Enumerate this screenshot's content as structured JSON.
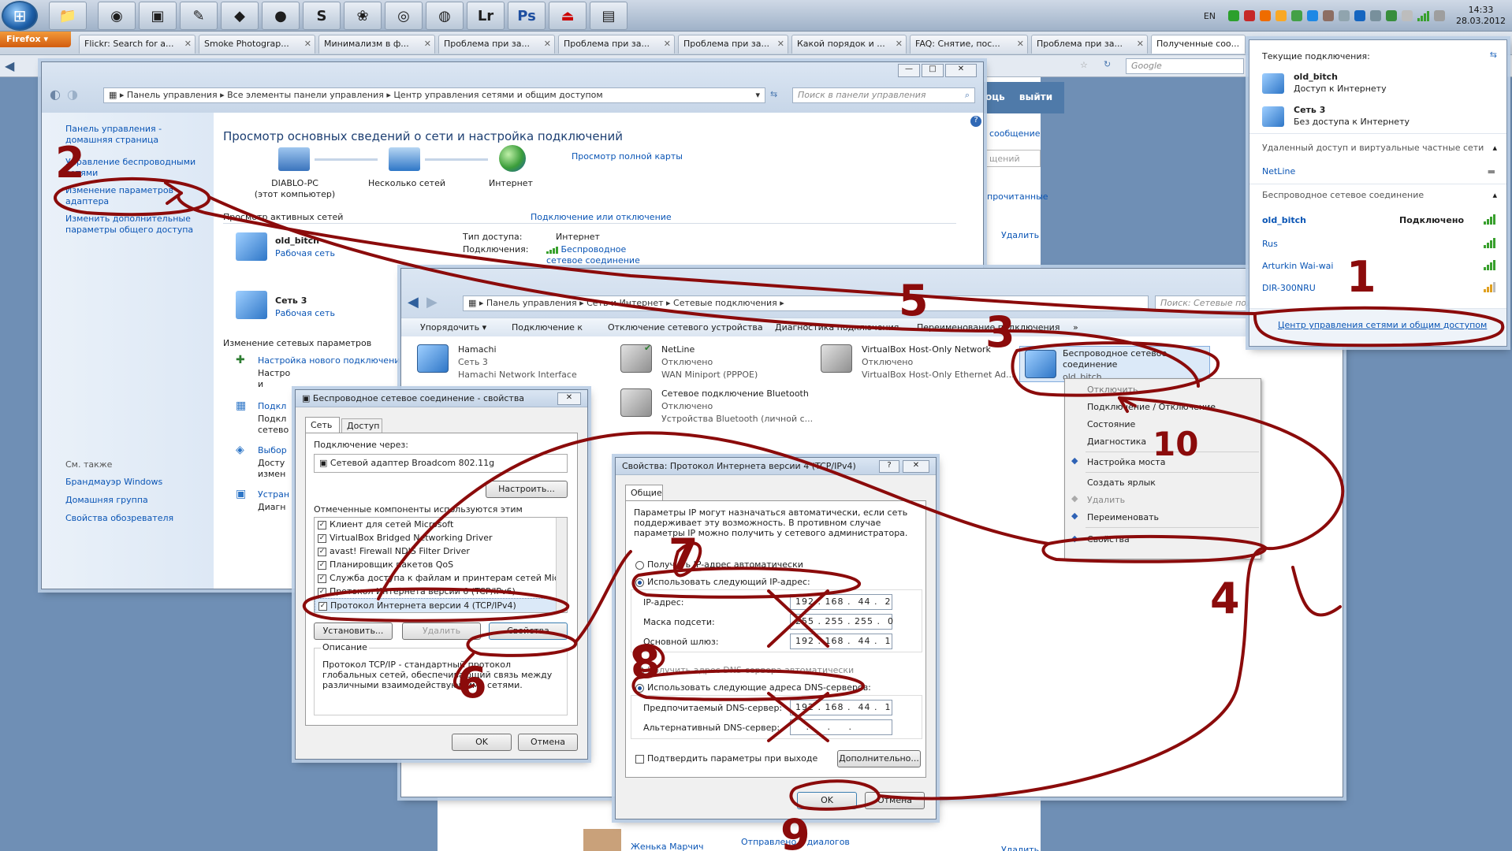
{
  "taskbar": {
    "lang": "EN",
    "clock_time": "14:33",
    "clock_date": "28.03.2012",
    "app_labels": [
      "Lr",
      "Ps"
    ]
  },
  "firefox": {
    "button": "Firefox",
    "tabs": [
      "Flickr: Search for a...",
      "Smoke Photograp...",
      "Минимализм в ф...",
      "Проблема при за...",
      "Проблема при за...",
      "Проблема при за...",
      "Какой порядок и ...",
      "FAQ: Снятие, пос...",
      "Проблема при за...",
      "Полученные соо..."
    ],
    "search_placeholder": "Google"
  },
  "behind": {
    "logout": "выйти",
    "exit_prefix": "оць",
    "write_message": "сообщение",
    "unread": "прочитанные",
    "delete1": "Удалить",
    "delete2": "Удалить",
    "search_fragment": "щений",
    "contact_name": "Женька Марчич",
    "sent_dialogs": "Отправлено в диалогов"
  },
  "nsc": {
    "breadcrumb": [
      "Панель управления",
      "Все элементы панели управления",
      "Центр управления сетями и общим доступом"
    ],
    "search_placeholder": "Поиск в панели управления",
    "sidebar": {
      "home": "Панель управления - домашняя страница",
      "wireless": "Управление беспроводными сетями",
      "adapter": "Изменение параметров адаптера",
      "sharing": "Изменить дополнительные параметры общего доступа",
      "see_also": "См. также",
      "firewall": "Брандмауэр Windows",
      "homegroup": "Домашняя группа",
      "browser": "Свойства обозревателя"
    },
    "heading": "Просмотр основных сведений о сети и настройка подключений",
    "full_map": "Просмотр полной карты",
    "map": {
      "pc": "DIABLO-PC",
      "pc_sub": "(этот компьютер)",
      "multi": "Несколько сетей",
      "internet": "Интернет"
    },
    "active_title": "Просмотр активных сетей",
    "connect_link": "Подключение или отключение",
    "net1": {
      "name": "old_bitch",
      "type": "Рабочая сеть",
      "access_label": "Тип доступа:",
      "access_value": "Интернет",
      "conn_label": "Подключения:",
      "conn_value": "Беспроводное сетевое соединение (old_bitch)"
    },
    "net2": {
      "name": "Сеть 3",
      "type": "Рабочая сеть"
    },
    "change_title": "Изменение сетевых параметров",
    "tasks": [
      "Настройка нового подключения",
      "Настро",
      "и",
      "Подкл",
      "Подкл",
      "сетево",
      "Выбор",
      "Досту",
      "измен",
      "Устран",
      "Диагн"
    ]
  },
  "conn": {
    "breadcrumb": [
      "Панель управления",
      "Сеть и Интернет",
      "Сетевые подключения"
    ],
    "search_placeholder": "Поиск: Сетевые подкл",
    "toolbar": [
      "Упорядочить",
      "Подключение к",
      "Отключение сетевого устройства",
      "Диагностика подключения",
      "Переименование подключения",
      "»"
    ],
    "items": [
      {
        "name": "Hamachi",
        "status": "Сеть 3",
        "device": "Hamachi Network Interface"
      },
      {
        "name": "NetLine",
        "status": "Отключено",
        "device": "WAN Miniport (PPPOE)"
      },
      {
        "name": "VirtualBox Host-Only Network",
        "status": "Отключено",
        "device": "VirtualBox Host-Only Ethernet Ad..."
      },
      {
        "name": "Беспроводное сетевое соединение",
        "status": "old_bitch",
        "device": ""
      },
      {
        "name": "Сетевое подключение Bluetooth",
        "status": "Отключено",
        "device": "Устройства Bluetooth (личной с..."
      }
    ]
  },
  "ctx": {
    "items": [
      "Отключить",
      "Подключение / Отключение",
      "Состояние",
      "Диагностика",
      "Настройка моста",
      "Создать ярлык",
      "Удалить",
      "Переименовать",
      "Свойства"
    ]
  },
  "props": {
    "title": "Беспроводное сетевое соединение - свойства",
    "tabs": [
      "Сеть",
      "Доступ"
    ],
    "connect_via_label": "Подключение через:",
    "adapter": "Сетевой адаптер Broadcom 802.11g",
    "configure": "Настроить...",
    "components_label": "Отмеченные компоненты используются этим подключением:",
    "components": [
      "Клиент для сетей Microsoft",
      "VirtualBox Bridged Networking Driver",
      "avast! Firewall NDIS Filter Driver",
      "Планировщик пакетов QoS",
      "Служба доступа к файлам и принтерам сетей Micro",
      "Протокол Интернета версии 6 (TCP/IPv6)",
      "Протокол Интернета версии 4 (TCP/IPv4)"
    ],
    "install": "Установить...",
    "uninstall": "Удалить",
    "properties": "Свойства",
    "desc_label": "Описание",
    "desc_text": "Протокол TCP/IP - стандартный протокол глобальных сетей, обеспечивающий связь между различными взаимодействующими сетями.",
    "ok": "OK",
    "cancel": "Отмена"
  },
  "ipv4": {
    "title": "Свойства: Протокол Интернета версии 4 (TCP/IPv4)",
    "tab": "Общие",
    "intro": "Параметры IP могут назначаться автоматически, если сеть поддерживает эту возможность. В противном случае параметры IP можно получить у сетевого администратора.",
    "auto_ip": "Получить IP-адрес автоматически",
    "manual_ip": "Использовать следующий IP-адрес:",
    "ip_label": "IP-адрес:",
    "ip_value": "192 . 168 .  44 .  2",
    "mask_label": "Маска подсети:",
    "mask_value": "255 . 255 . 255 .  0",
    "gw_label": "Основной шлюз:",
    "gw_value": "192 . 168 .  44 .  1",
    "auto_dns": "Получить адрес DNS-сервера автоматически",
    "manual_dns": "Использовать следующие адреса DNS-серверов:",
    "pref_label": "Предпочитаемый DNS-сервер:",
    "pref_value": "192 . 168 .  44 .  1",
    "alt_label": "Альтернативный DNS-сервер:",
    "alt_value": "   .     .     .   ",
    "validate": "Подтвердить параметры при выходе",
    "advanced": "Дополнительно...",
    "ok": "OK",
    "cancel": "Отмена"
  },
  "popup": {
    "current": "Текущие подключения:",
    "c1_name": "old_bitch",
    "c1_status": "Доступ к Интернету",
    "c2_name": "Сеть 3",
    "c2_status": "Без доступа к Интернету",
    "vpn_title": "Удаленный доступ и виртуальные частные сети",
    "vpn_item": "NetLine",
    "wifi_title": "Беспроводное сетевое соединение",
    "wifi_items": [
      "old_bitch",
      "Rus",
      "Arturkin Wai-wai",
      "DIR-300NRU"
    ],
    "connected": "Подключено",
    "center_link": "Центр управления сетями и общим доступом"
  },
  "annotations": [
    "1",
    "2",
    "3",
    "4",
    "5",
    "6",
    "7",
    "8",
    "9",
    "10"
  ]
}
